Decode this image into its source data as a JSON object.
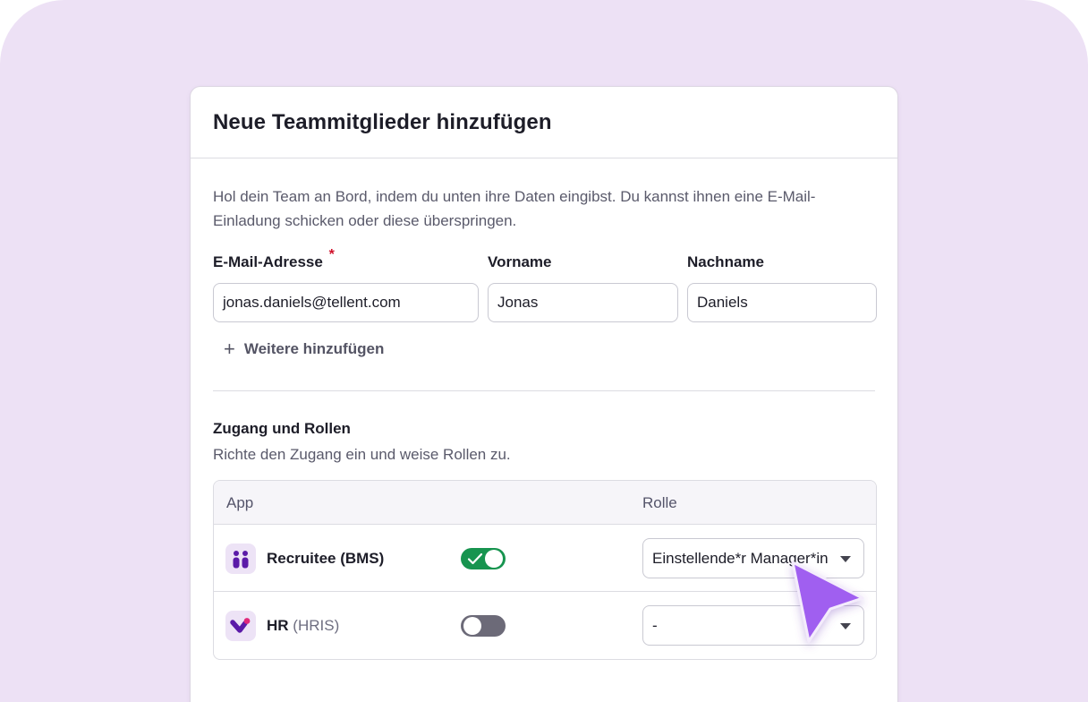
{
  "dialog": {
    "title": "Neue Teammitglieder hinzufügen",
    "intro": "Hol dein Team an Bord, indem du unten ihre Daten eingibst. Du kannst ihnen eine E-Mail-Einladung schicken oder diese überspringen."
  },
  "fields": {
    "email": {
      "label": "E-Mail-Adresse",
      "required_mark": "*",
      "value": "jonas.daniels@tellent.com"
    },
    "first_name": {
      "label": "Vorname",
      "value": "Jonas"
    },
    "last_name": {
      "label": "Nachname",
      "value": "Daniels"
    }
  },
  "add_more_label": "Weitere hinzufügen",
  "access": {
    "title": "Zugang und Rollen",
    "description": "Richte den Zugang ein und weise Rollen zu.",
    "columns": {
      "app": "App",
      "role": "Rolle"
    },
    "rows": [
      {
        "app": "Recruitee (BMS)",
        "app_suffix": "",
        "enabled": true,
        "role": "Einstellende*r Manager*in",
        "icon": "recruitee-logo-icon"
      },
      {
        "app": "HR",
        "app_suffix": "(HRIS)",
        "enabled": false,
        "role": "-",
        "icon": "hr-logo-icon"
      }
    ]
  },
  "colors": {
    "background": "#ede1f5",
    "toggle_on": "#17944f",
    "toggle_off": "#6c6a78",
    "cursor": "#a05ef0",
    "brand_purple": "#5b1aa8"
  }
}
